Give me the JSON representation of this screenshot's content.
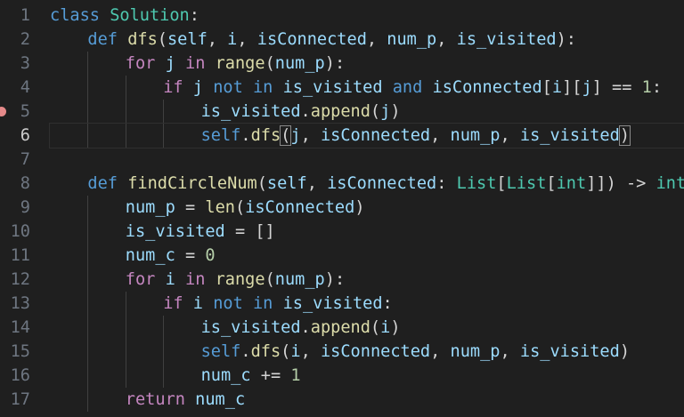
{
  "editor": {
    "language": "python",
    "current_line": 6,
    "breakpoint_line": 5,
    "lines": [
      {
        "n": "1",
        "indent": 0,
        "tokens": [
          [
            "kw",
            "class"
          ],
          [
            "op",
            " "
          ],
          [
            "cls",
            "Solution"
          ],
          [
            "op",
            ":"
          ]
        ]
      },
      {
        "n": "2",
        "indent": 1,
        "tokens": [
          [
            "kw",
            "def"
          ],
          [
            "op",
            " "
          ],
          [
            "fn",
            "dfs"
          ],
          [
            "op",
            "("
          ],
          [
            "var",
            "self"
          ],
          [
            "op",
            ", "
          ],
          [
            "var",
            "i"
          ],
          [
            "op",
            ", "
          ],
          [
            "var",
            "isConnected"
          ],
          [
            "op",
            ", "
          ],
          [
            "var",
            "num_p"
          ],
          [
            "op",
            ", "
          ],
          [
            "var",
            "is_visited"
          ],
          [
            "op",
            "):"
          ]
        ]
      },
      {
        "n": "3",
        "indent": 2,
        "tokens": [
          [
            "ctl",
            "for"
          ],
          [
            "op",
            " "
          ],
          [
            "var",
            "j"
          ],
          [
            "op",
            " "
          ],
          [
            "ctl",
            "in"
          ],
          [
            "op",
            " "
          ],
          [
            "fn",
            "range"
          ],
          [
            "op",
            "("
          ],
          [
            "var",
            "num_p"
          ],
          [
            "op",
            "):"
          ]
        ]
      },
      {
        "n": "4",
        "indent": 3,
        "tokens": [
          [
            "ctl",
            "if"
          ],
          [
            "op",
            " "
          ],
          [
            "var",
            "j"
          ],
          [
            "op",
            " "
          ],
          [
            "kw",
            "not"
          ],
          [
            "op",
            " "
          ],
          [
            "kw",
            "in"
          ],
          [
            "op",
            " "
          ],
          [
            "var",
            "is_visited"
          ],
          [
            "op",
            " "
          ],
          [
            "kw",
            "and"
          ],
          [
            "op",
            " "
          ],
          [
            "var",
            "isConnected"
          ],
          [
            "op",
            "["
          ],
          [
            "var",
            "i"
          ],
          [
            "op",
            "]["
          ],
          [
            "var",
            "j"
          ],
          [
            "op",
            "] == "
          ],
          [
            "num",
            "1"
          ],
          [
            "op",
            ":"
          ]
        ]
      },
      {
        "n": "5",
        "indent": 4,
        "tokens": [
          [
            "var",
            "is_visited"
          ],
          [
            "op",
            "."
          ],
          [
            "fn",
            "append"
          ],
          [
            "op",
            "("
          ],
          [
            "var",
            "j"
          ],
          [
            "op",
            ")"
          ]
        ]
      },
      {
        "n": "6",
        "indent": 4,
        "tokens": [
          [
            "kw",
            "self"
          ],
          [
            "op",
            "."
          ],
          [
            "fn",
            "dfs"
          ],
          [
            "br",
            "("
          ],
          [
            "var",
            "j"
          ],
          [
            "op",
            ", "
          ],
          [
            "var",
            "isConnected"
          ],
          [
            "op",
            ", "
          ],
          [
            "var",
            "num_p"
          ],
          [
            "op",
            ", "
          ],
          [
            "var",
            "is_visited"
          ],
          [
            "br",
            ")"
          ]
        ]
      },
      {
        "n": "7",
        "indent": 0,
        "tokens": []
      },
      {
        "n": "8",
        "indent": 1,
        "tokens": [
          [
            "kw",
            "def"
          ],
          [
            "op",
            " "
          ],
          [
            "fn",
            "findCircleNum"
          ],
          [
            "op",
            "("
          ],
          [
            "var",
            "self"
          ],
          [
            "op",
            ", "
          ],
          [
            "var",
            "isConnected"
          ],
          [
            "op",
            ": "
          ],
          [
            "cls",
            "List"
          ],
          [
            "op",
            "["
          ],
          [
            "cls",
            "List"
          ],
          [
            "op",
            "["
          ],
          [
            "cls",
            "int"
          ],
          [
            "op",
            "]]) -> "
          ],
          [
            "cls",
            "int"
          ],
          [
            "op",
            ":"
          ]
        ]
      },
      {
        "n": "9",
        "indent": 2,
        "tokens": [
          [
            "var",
            "num_p"
          ],
          [
            "op",
            " = "
          ],
          [
            "fn",
            "len"
          ],
          [
            "op",
            "("
          ],
          [
            "var",
            "isConnected"
          ],
          [
            "op",
            ")"
          ]
        ]
      },
      {
        "n": "10",
        "indent": 2,
        "tokens": [
          [
            "var",
            "is_visited"
          ],
          [
            "op",
            " = []"
          ]
        ]
      },
      {
        "n": "11",
        "indent": 2,
        "tokens": [
          [
            "var",
            "num_c"
          ],
          [
            "op",
            " = "
          ],
          [
            "num",
            "0"
          ]
        ]
      },
      {
        "n": "12",
        "indent": 2,
        "tokens": [
          [
            "ctl",
            "for"
          ],
          [
            "op",
            " "
          ],
          [
            "var",
            "i"
          ],
          [
            "op",
            " "
          ],
          [
            "ctl",
            "in"
          ],
          [
            "op",
            " "
          ],
          [
            "fn",
            "range"
          ],
          [
            "op",
            "("
          ],
          [
            "var",
            "num_p"
          ],
          [
            "op",
            "):"
          ]
        ]
      },
      {
        "n": "13",
        "indent": 3,
        "tokens": [
          [
            "ctl",
            "if"
          ],
          [
            "op",
            " "
          ],
          [
            "var",
            "i"
          ],
          [
            "op",
            " "
          ],
          [
            "kw",
            "not"
          ],
          [
            "op",
            " "
          ],
          [
            "kw",
            "in"
          ],
          [
            "op",
            " "
          ],
          [
            "var",
            "is_visited"
          ],
          [
            "op",
            ":"
          ]
        ]
      },
      {
        "n": "14",
        "indent": 4,
        "tokens": [
          [
            "var",
            "is_visited"
          ],
          [
            "op",
            "."
          ],
          [
            "fn",
            "append"
          ],
          [
            "op",
            "("
          ],
          [
            "var",
            "i"
          ],
          [
            "op",
            ")"
          ]
        ]
      },
      {
        "n": "15",
        "indent": 4,
        "tokens": [
          [
            "kw",
            "self"
          ],
          [
            "op",
            "."
          ],
          [
            "fn",
            "dfs"
          ],
          [
            "op",
            "("
          ],
          [
            "var",
            "i"
          ],
          [
            "op",
            ", "
          ],
          [
            "var",
            "isConnected"
          ],
          [
            "op",
            ", "
          ],
          [
            "var",
            "num_p"
          ],
          [
            "op",
            ", "
          ],
          [
            "var",
            "is_visited"
          ],
          [
            "op",
            ")"
          ]
        ]
      },
      {
        "n": "16",
        "indent": 4,
        "tokens": [
          [
            "var",
            "num_c"
          ],
          [
            "op",
            " += "
          ],
          [
            "num",
            "1"
          ]
        ]
      },
      {
        "n": "17",
        "indent": 2,
        "tokens": [
          [
            "ctl",
            "return"
          ],
          [
            "op",
            " "
          ],
          [
            "var",
            "num_c"
          ]
        ]
      }
    ]
  }
}
